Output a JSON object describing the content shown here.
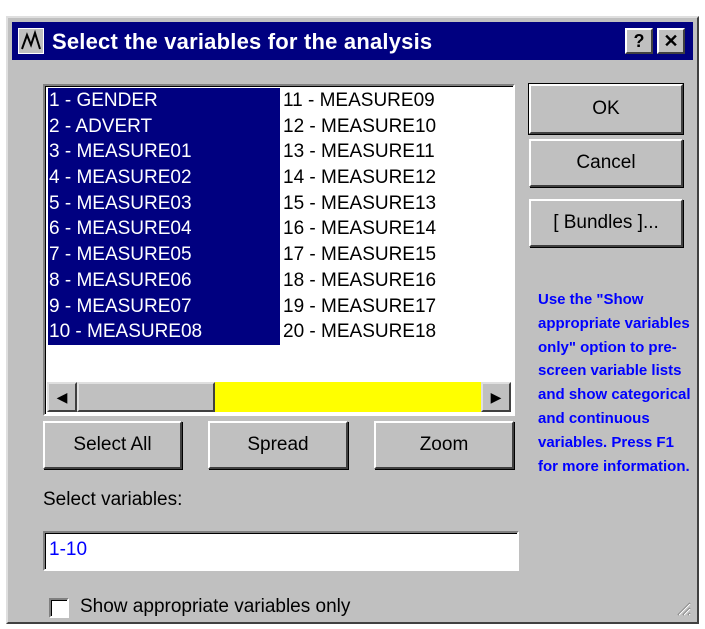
{
  "window": {
    "title": "Select the variables for the analysis",
    "help_label": "?",
    "close_label": "✕"
  },
  "variables": {
    "column1": [
      {
        "label": "1 - GENDER",
        "selected": true
      },
      {
        "label": "2 - ADVERT",
        "selected": true
      },
      {
        "label": "3 - MEASURE01",
        "selected": true
      },
      {
        "label": "4 - MEASURE02",
        "selected": true
      },
      {
        "label": "5 - MEASURE03",
        "selected": true
      },
      {
        "label": "6 - MEASURE04",
        "selected": true
      },
      {
        "label": "7 - MEASURE05",
        "selected": true
      },
      {
        "label": "8 - MEASURE06",
        "selected": true
      },
      {
        "label": "9 - MEASURE07",
        "selected": true
      },
      {
        "label": "10 - MEASURE08",
        "selected": true
      }
    ],
    "column2": [
      {
        "label": "11 - MEASURE09",
        "selected": false
      },
      {
        "label": "12 - MEASURE10",
        "selected": false
      },
      {
        "label": "13 - MEASURE11",
        "selected": false
      },
      {
        "label": "14 - MEASURE12",
        "selected": false
      },
      {
        "label": "15 - MEASURE13",
        "selected": false
      },
      {
        "label": "16 - MEASURE14",
        "selected": false
      },
      {
        "label": "17 - MEASURE15",
        "selected": false
      },
      {
        "label": "18 - MEASURE16",
        "selected": false
      },
      {
        "label": "19 - MEASURE17",
        "selected": false
      },
      {
        "label": "20 - MEASURE18",
        "selected": false
      }
    ]
  },
  "buttons": {
    "ok": "OK",
    "cancel": "Cancel",
    "bundles": "[ Bundles ]...",
    "select_all": "Select All",
    "spread": "Spread",
    "zoom": "Zoom"
  },
  "hint_text": "Use the \"Show appropriate variables only\" option to pre-screen variable lists and show categorical and continuous variables. Press F1 for more information.",
  "select_variables": {
    "label": "Select variables:",
    "value": "1-10"
  },
  "checkbox": {
    "label": "Show appropriate variables only",
    "checked": false
  },
  "colors": {
    "selection": "#000080",
    "hint_text": "#0000ff",
    "scrollbar_track": "#ffff00",
    "dialog_face": "#c0c0c0"
  }
}
